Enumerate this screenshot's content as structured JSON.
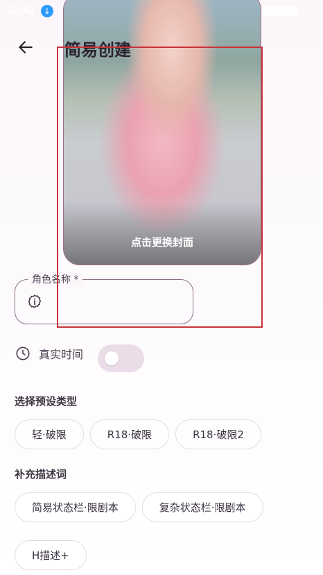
{
  "status": {
    "time": "10:47"
  },
  "header": {
    "title": "简易创建"
  },
  "cover": {
    "caption": "点击更换封面"
  },
  "form": {
    "name_label": "角色名称 *",
    "name_value": ""
  },
  "realtime": {
    "label": "真实时间",
    "enabled": false
  },
  "preset": {
    "title": "选择预设类型",
    "options": [
      "轻·破限",
      "R18·破限",
      "R18·破限2"
    ]
  },
  "descriptors": {
    "title": "补充描述词",
    "options": [
      "简易状态栏·限剧本",
      "复杂状态栏·限剧本",
      "H描述+"
    ]
  },
  "colors": {
    "accent": "#c8323a",
    "toggle_track": "#eadde8",
    "field_border": "#8b6d86"
  }
}
